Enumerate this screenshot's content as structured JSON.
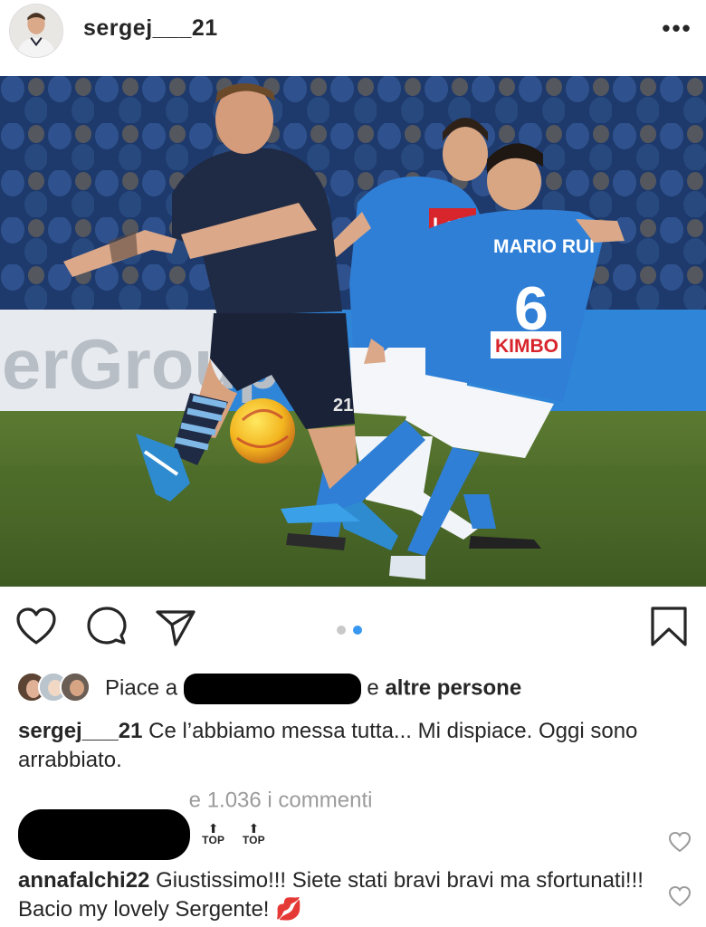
{
  "header": {
    "username": "sergej___21",
    "more_label": "•••"
  },
  "photo": {
    "jersey_back_name": "MARIO RUI",
    "jersey_back_number": "6",
    "sponsor_back": "KIMBO",
    "sponsor_front": "Lete",
    "board_text": "erGroup",
    "shorts_number": "21"
  },
  "actions": {
    "icons": [
      "heart-icon",
      "comment-icon",
      "share-icon",
      "bookmark-icon"
    ],
    "carousel_total": 2,
    "carousel_active": 2
  },
  "likes": {
    "prefix": "Piace a",
    "joiner": "e",
    "suffix": "altre persone"
  },
  "caption": {
    "username": "sergej___21",
    "text": "Ce l’abbiamo messa tutta... Mi dispiace. Oggi sono arrabbiato."
  },
  "comments_link": {
    "visible_text": "e 1.036 i commenti"
  },
  "comments": [
    {
      "badges": [
        {
          "arrow": "⬆",
          "label": "TOP"
        },
        {
          "arrow": "⬆",
          "label": "TOP"
        }
      ]
    },
    {
      "username": "annafalchi22",
      "text": "Giustissimo!!! Siete stati bravi bravi ma sfortunati!!! Bacio my lovely Sergente!",
      "emoji": "💋"
    }
  ],
  "colors": {
    "text": "#262626",
    "muted": "#9b9b9b",
    "accent_dot": "#3897f0",
    "napoli_blue": "#2f7fd6",
    "lazio_navy": "#1f2a44",
    "pitch": "#4f6b2c"
  }
}
